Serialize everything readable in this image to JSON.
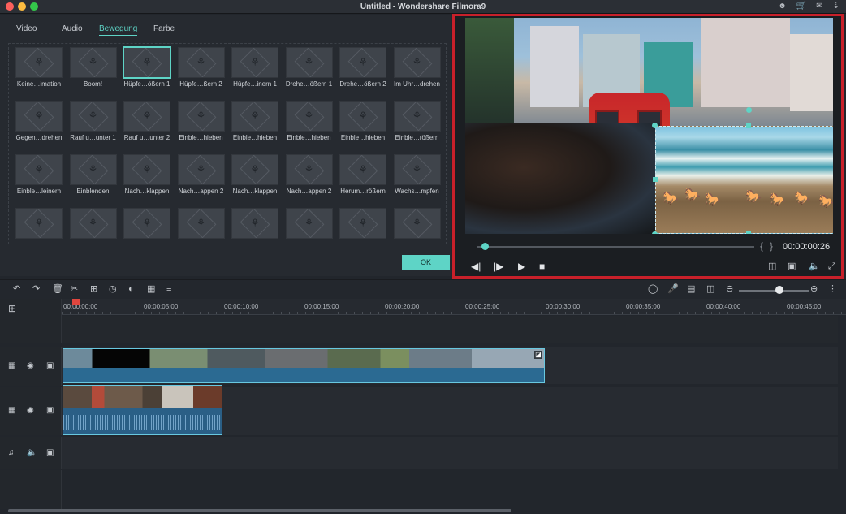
{
  "window": {
    "title": "Untitled - Wondershare Filmora9"
  },
  "titlebar_icons": [
    "person-icon",
    "cart-icon",
    "mail-icon",
    "download-icon"
  ],
  "tabs": [
    {
      "label": "Video",
      "active": false
    },
    {
      "label": "Audio",
      "active": false
    },
    {
      "label": "Bewegung",
      "active": true
    },
    {
      "label": "Farbe",
      "active": false
    }
  ],
  "motions": [
    "Keine…imation",
    "Boom!",
    "Hüpfe…ößern 1",
    "Hüpfe…ßern 2",
    "Hüpfe…inern 1",
    "Drehe…ößern 1",
    "Drehe…ößern 2",
    "Im Uhr…drehen",
    "Gegen…drehen",
    "Rauf u…unter 1",
    "Rauf u…unter 2",
    "Einble…hieben",
    "Einble…hieben",
    "Einble…hieben",
    "Einble…hieben",
    "Einble…rößern",
    "Einble…leinern",
    "Einblenden",
    "Nach…klappen",
    "Nach…appen 2",
    "Nach…klappen",
    "Nach…appen 2",
    "Herum…rößern",
    "Wachs…mpfen",
    "",
    "",
    "",
    "",
    "",
    "",
    "",
    ""
  ],
  "selected_motion_index": 2,
  "ok_label": "OK",
  "preview": {
    "timecode": "00:00:00:26",
    "progress": 0.02
  },
  "timeline": {
    "ruler": [
      "00:00:00:00",
      "00:00:05:00",
      "00:00:10:00",
      "00:00:15:00",
      "00:00:20:00",
      "00:00:25:00",
      "00:00:30:00",
      "00:00:35:00",
      "00:00:40:00",
      "00:00:45:00"
    ]
  },
  "colors": {
    "accent": "#5ed4c6",
    "highlight_frame": "#c8202a",
    "playhead": "#e0463e",
    "clip_border": "#68c8e0"
  }
}
